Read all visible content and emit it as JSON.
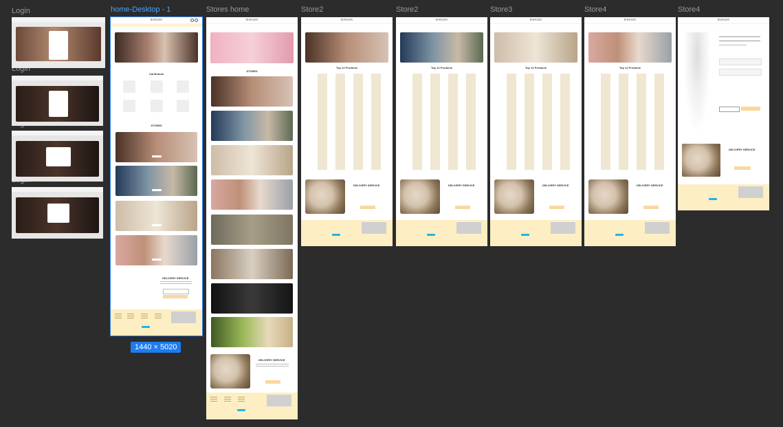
{
  "labels": {
    "login": "Login",
    "home_desktop": "home-Desktop - 1",
    "stores_home": "Stores home",
    "store2a": "Store2",
    "store2b": "Store2",
    "store3": "Store3",
    "store4a": "Store4",
    "store4b": "Store4"
  },
  "size_badge": "1440 × 5020",
  "brand": "JEWELRY",
  "home": {
    "cat_title": "Cat Brands",
    "stores_title": "STORES",
    "delivery_title": "DELIVERY SERVICE"
  },
  "stores_home": {
    "stores_title": "STORES",
    "delivery_title": "DELIVERY SERVICE"
  },
  "store_pages": {
    "top_title": "Top 12 Products",
    "delivery_title": "DELIVERY SERVICE"
  },
  "colors": {
    "canvas": "#2c2c2c",
    "footer": "#fdefc3",
    "nav": "#fdf3d4",
    "accent_button": "#22b3e6",
    "selection": "#2f8cff"
  }
}
